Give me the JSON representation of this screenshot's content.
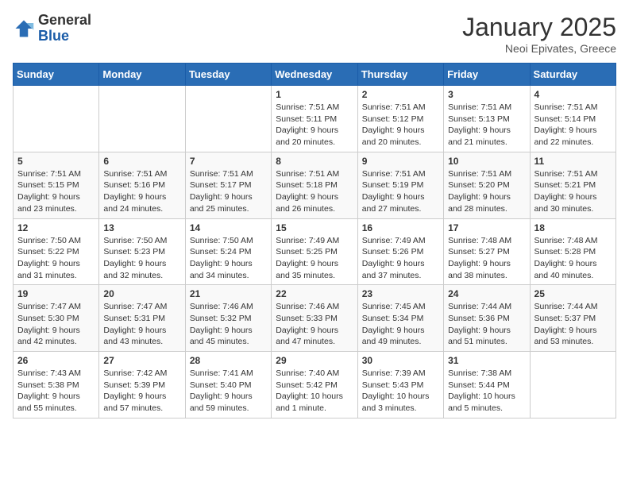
{
  "header": {
    "logo": {
      "general": "General",
      "blue": "Blue"
    },
    "month": "January 2025",
    "location": "Neoi Epivates, Greece"
  },
  "weekdays": [
    "Sunday",
    "Monday",
    "Tuesday",
    "Wednesday",
    "Thursday",
    "Friday",
    "Saturday"
  ],
  "weeks": [
    [
      {
        "day": "",
        "info": ""
      },
      {
        "day": "",
        "info": ""
      },
      {
        "day": "",
        "info": ""
      },
      {
        "day": "1",
        "info": "Sunrise: 7:51 AM\nSunset: 5:11 PM\nDaylight: 9 hours\nand 20 minutes."
      },
      {
        "day": "2",
        "info": "Sunrise: 7:51 AM\nSunset: 5:12 PM\nDaylight: 9 hours\nand 20 minutes."
      },
      {
        "day": "3",
        "info": "Sunrise: 7:51 AM\nSunset: 5:13 PM\nDaylight: 9 hours\nand 21 minutes."
      },
      {
        "day": "4",
        "info": "Sunrise: 7:51 AM\nSunset: 5:14 PM\nDaylight: 9 hours\nand 22 minutes."
      }
    ],
    [
      {
        "day": "5",
        "info": "Sunrise: 7:51 AM\nSunset: 5:15 PM\nDaylight: 9 hours\nand 23 minutes."
      },
      {
        "day": "6",
        "info": "Sunrise: 7:51 AM\nSunset: 5:16 PM\nDaylight: 9 hours\nand 24 minutes."
      },
      {
        "day": "7",
        "info": "Sunrise: 7:51 AM\nSunset: 5:17 PM\nDaylight: 9 hours\nand 25 minutes."
      },
      {
        "day": "8",
        "info": "Sunrise: 7:51 AM\nSunset: 5:18 PM\nDaylight: 9 hours\nand 26 minutes."
      },
      {
        "day": "9",
        "info": "Sunrise: 7:51 AM\nSunset: 5:19 PM\nDaylight: 9 hours\nand 27 minutes."
      },
      {
        "day": "10",
        "info": "Sunrise: 7:51 AM\nSunset: 5:20 PM\nDaylight: 9 hours\nand 28 minutes."
      },
      {
        "day": "11",
        "info": "Sunrise: 7:51 AM\nSunset: 5:21 PM\nDaylight: 9 hours\nand 30 minutes."
      }
    ],
    [
      {
        "day": "12",
        "info": "Sunrise: 7:50 AM\nSunset: 5:22 PM\nDaylight: 9 hours\nand 31 minutes."
      },
      {
        "day": "13",
        "info": "Sunrise: 7:50 AM\nSunset: 5:23 PM\nDaylight: 9 hours\nand 32 minutes."
      },
      {
        "day": "14",
        "info": "Sunrise: 7:50 AM\nSunset: 5:24 PM\nDaylight: 9 hours\nand 34 minutes."
      },
      {
        "day": "15",
        "info": "Sunrise: 7:49 AM\nSunset: 5:25 PM\nDaylight: 9 hours\nand 35 minutes."
      },
      {
        "day": "16",
        "info": "Sunrise: 7:49 AM\nSunset: 5:26 PM\nDaylight: 9 hours\nand 37 minutes."
      },
      {
        "day": "17",
        "info": "Sunrise: 7:48 AM\nSunset: 5:27 PM\nDaylight: 9 hours\nand 38 minutes."
      },
      {
        "day": "18",
        "info": "Sunrise: 7:48 AM\nSunset: 5:28 PM\nDaylight: 9 hours\nand 40 minutes."
      }
    ],
    [
      {
        "day": "19",
        "info": "Sunrise: 7:47 AM\nSunset: 5:30 PM\nDaylight: 9 hours\nand 42 minutes."
      },
      {
        "day": "20",
        "info": "Sunrise: 7:47 AM\nSunset: 5:31 PM\nDaylight: 9 hours\nand 43 minutes."
      },
      {
        "day": "21",
        "info": "Sunrise: 7:46 AM\nSunset: 5:32 PM\nDaylight: 9 hours\nand 45 minutes."
      },
      {
        "day": "22",
        "info": "Sunrise: 7:46 AM\nSunset: 5:33 PM\nDaylight: 9 hours\nand 47 minutes."
      },
      {
        "day": "23",
        "info": "Sunrise: 7:45 AM\nSunset: 5:34 PM\nDaylight: 9 hours\nand 49 minutes."
      },
      {
        "day": "24",
        "info": "Sunrise: 7:44 AM\nSunset: 5:36 PM\nDaylight: 9 hours\nand 51 minutes."
      },
      {
        "day": "25",
        "info": "Sunrise: 7:44 AM\nSunset: 5:37 PM\nDaylight: 9 hours\nand 53 minutes."
      }
    ],
    [
      {
        "day": "26",
        "info": "Sunrise: 7:43 AM\nSunset: 5:38 PM\nDaylight: 9 hours\nand 55 minutes."
      },
      {
        "day": "27",
        "info": "Sunrise: 7:42 AM\nSunset: 5:39 PM\nDaylight: 9 hours\nand 57 minutes."
      },
      {
        "day": "28",
        "info": "Sunrise: 7:41 AM\nSunset: 5:40 PM\nDaylight: 9 hours\nand 59 minutes."
      },
      {
        "day": "29",
        "info": "Sunrise: 7:40 AM\nSunset: 5:42 PM\nDaylight: 10 hours\nand 1 minute."
      },
      {
        "day": "30",
        "info": "Sunrise: 7:39 AM\nSunset: 5:43 PM\nDaylight: 10 hours\nand 3 minutes."
      },
      {
        "day": "31",
        "info": "Sunrise: 7:38 AM\nSunset: 5:44 PM\nDaylight: 10 hours\nand 5 minutes."
      },
      {
        "day": "",
        "info": ""
      }
    ]
  ]
}
